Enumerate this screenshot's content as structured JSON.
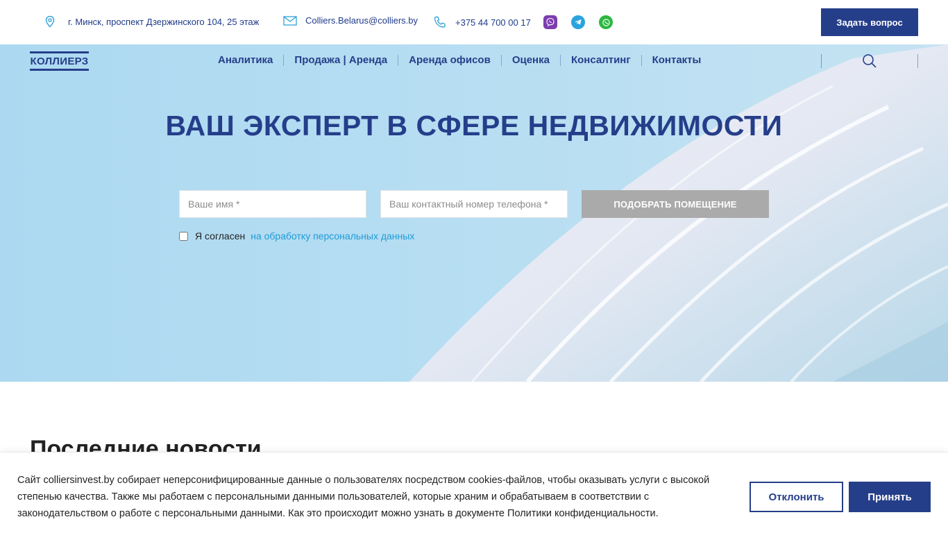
{
  "topbar": {
    "address": "г. Минск, проспект Дзержинского 104, 25 этаж",
    "email": "Colliers.Belarus@colliers.by",
    "phone": "+375 44 700 00 17",
    "ask_button": "Задать вопрос",
    "socials": [
      "viber-icon",
      "telegram-icon",
      "whatsapp-icon"
    ]
  },
  "nav": {
    "logo": "КОЛЛИЕРЗ",
    "items": [
      "Аналитика",
      "Продажа | Аренда",
      "Аренда офисов",
      "Оценка",
      "Консалтинг",
      "Контакты"
    ]
  },
  "hero": {
    "headline": "ВАШ ЭКСПЕРТ В СФЕРЕ НЕДВИЖИМОСТИ",
    "name_placeholder": "Ваше имя *",
    "phone_placeholder": "Ваш контактный номер телефона *",
    "submit": "ПОДОБРАТЬ ПОМЕЩЕНИЕ",
    "consent_text": "Я согласен",
    "consent_link": "на обработку персональных данных"
  },
  "news": {
    "title": "Последние новости"
  },
  "cookie": {
    "text": "Сайт colliersinvest.by собирает неперсонифицированные данные о пользователях посредством cookies-файлов, чтобы оказывать услуги с высокой степенью качества. Также мы работаем с персональными данными пользователей, которые храним и обрабатываем в соответствии с законодательством о работе с персональными данными. Как это происходит можно узнать в документе Политики конфиденциальности.",
    "decline": "Отклонить",
    "accept": "Принять"
  },
  "colors": {
    "brand": "#253e8a",
    "hero_bg": "#b4dcf2",
    "link": "#1f9bd6",
    "button_disabled": "#aaaaaa"
  }
}
